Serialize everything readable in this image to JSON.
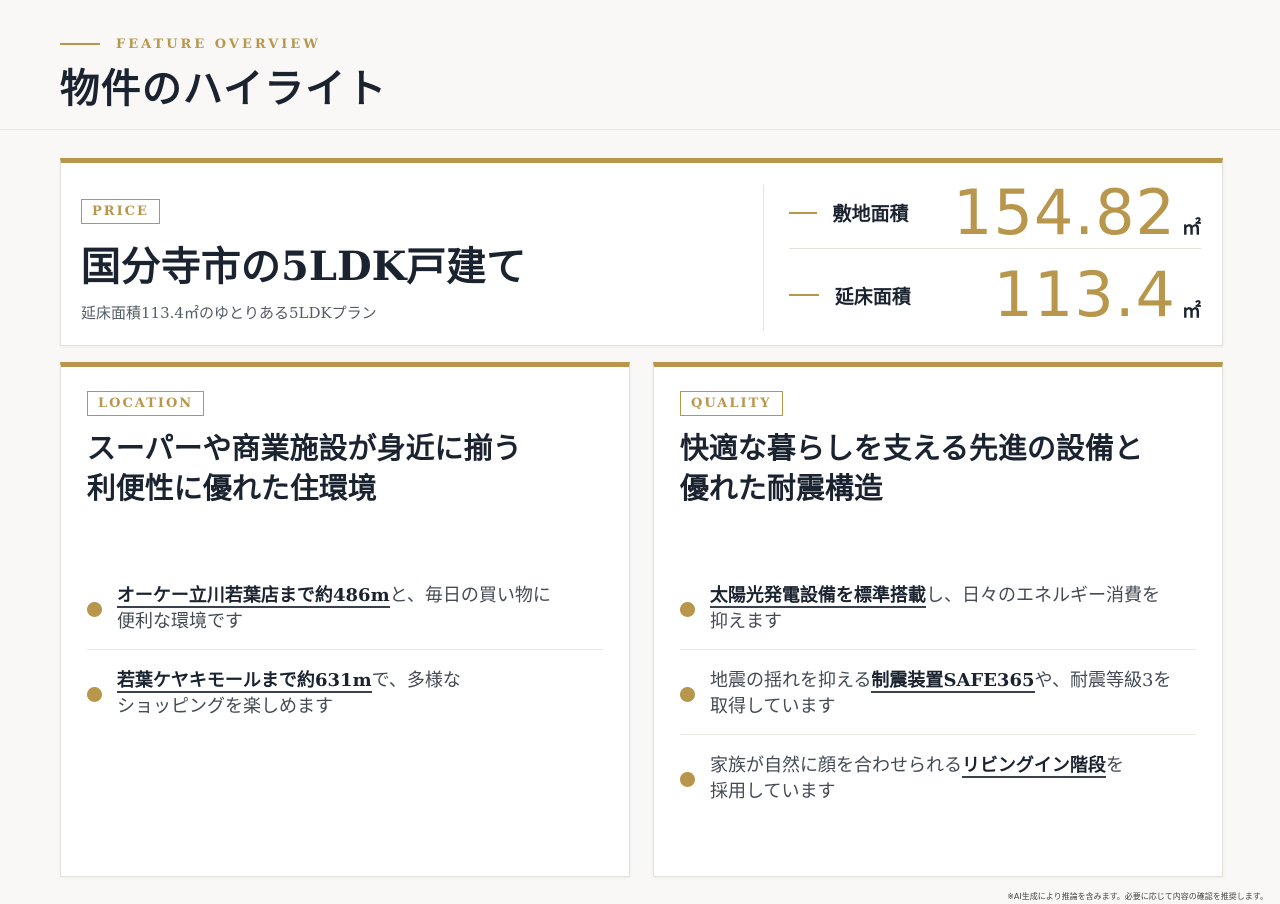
{
  "header": {
    "eyebrow": "FEATURE OVERVIEW",
    "title": "物件のハイライト"
  },
  "price": {
    "tag": "PRICE",
    "title": "国分寺市の5LDK戸建て",
    "subtitle": "延床面積113.4㎡のゆとりある5LDKプラン",
    "specs": [
      {
        "label": "敷地面積",
        "value": "154.82",
        "unit": "㎡"
      },
      {
        "label": "延床面積",
        "value": "113.4",
        "unit": "㎡"
      }
    ]
  },
  "location": {
    "tag": "LOCATION",
    "heading_line1": "スーパーや商業施設が身近に揃う",
    "heading_line2": "利便性に優れた住環境",
    "items": [
      {
        "pre": "",
        "strong": "オーケー立川若葉店まで約486m",
        "post": "と、毎日の買い物に",
        "line2": "便利な環境です"
      },
      {
        "pre": "",
        "strong": "若葉ケヤキモールまで約631m",
        "post": "で、多様な",
        "line2": "ショッピングを楽しめます"
      }
    ]
  },
  "quality": {
    "tag": "QUALITY",
    "heading_line1": "快適な暮らしを支える先進の設備と",
    "heading_line2": "優れた耐震構造",
    "items": [
      {
        "pre": "",
        "strong": "太陽光発電設備を標準搭載",
        "post": "し、日々のエネルギー消費を",
        "line2": "抑えます"
      },
      {
        "pre": "地震の揺れを抑える",
        "strong": "制震装置SAFE365",
        "post": "や、耐震等級3を",
        "line2": "取得しています"
      },
      {
        "pre": "家族が自然に顔を合わせられる",
        "strong": "リビングイン階段",
        "post": "を",
        "line2": "採用しています"
      }
    ]
  },
  "footnote": "※AI生成により推論を含みます。必要に応じて内容の確認を推奨します。",
  "colors": {
    "accent": "#b8974d",
    "text": "#1b2330"
  }
}
